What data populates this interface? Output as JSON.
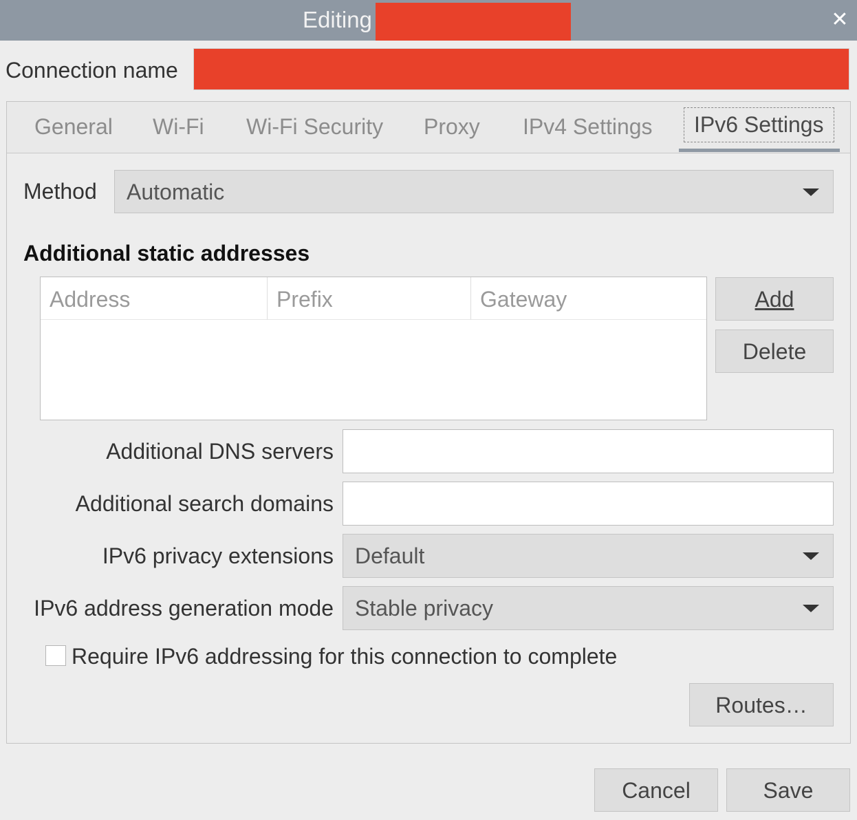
{
  "window": {
    "title_prefix": "Editing",
    "close_glyph": "✕"
  },
  "connection": {
    "label": "Connection name",
    "label_mnemonic_index": 11
  },
  "tabs": [
    {
      "label": "General",
      "active": false
    },
    {
      "label": "Wi-Fi",
      "active": false
    },
    {
      "label": "Wi-Fi Security",
      "active": false
    },
    {
      "label": "Proxy",
      "active": false
    },
    {
      "label": "IPv4 Settings",
      "active": false
    },
    {
      "label": "IPv6 Settings",
      "active": true
    }
  ],
  "ipv6": {
    "method_label": "Method",
    "method_value": "Automatic",
    "addresses_title": "Additional static addresses",
    "columns": [
      "Address",
      "Prefix",
      "Gateway"
    ],
    "rows": [],
    "add_label": "Add",
    "delete_label": "Delete",
    "dns_label": "Additional DNS servers",
    "dns_value": "",
    "search_label": "Additional search domains",
    "search_value": "",
    "privacy_label": "IPv6 privacy extensions",
    "privacy_value": "Default",
    "genmode_label": "IPv6 address generation mode",
    "genmode_value": "Stable privacy",
    "require_label": "Require IPv6 addressing for this connection to complete",
    "require_checked": false,
    "routes_label": "Routes…"
  },
  "footer": {
    "cancel_label": "Cancel",
    "save_label": "Save"
  },
  "colors": {
    "titlebar": "#8e98a3",
    "redaction": "#e8412a",
    "background": "#ededed"
  }
}
